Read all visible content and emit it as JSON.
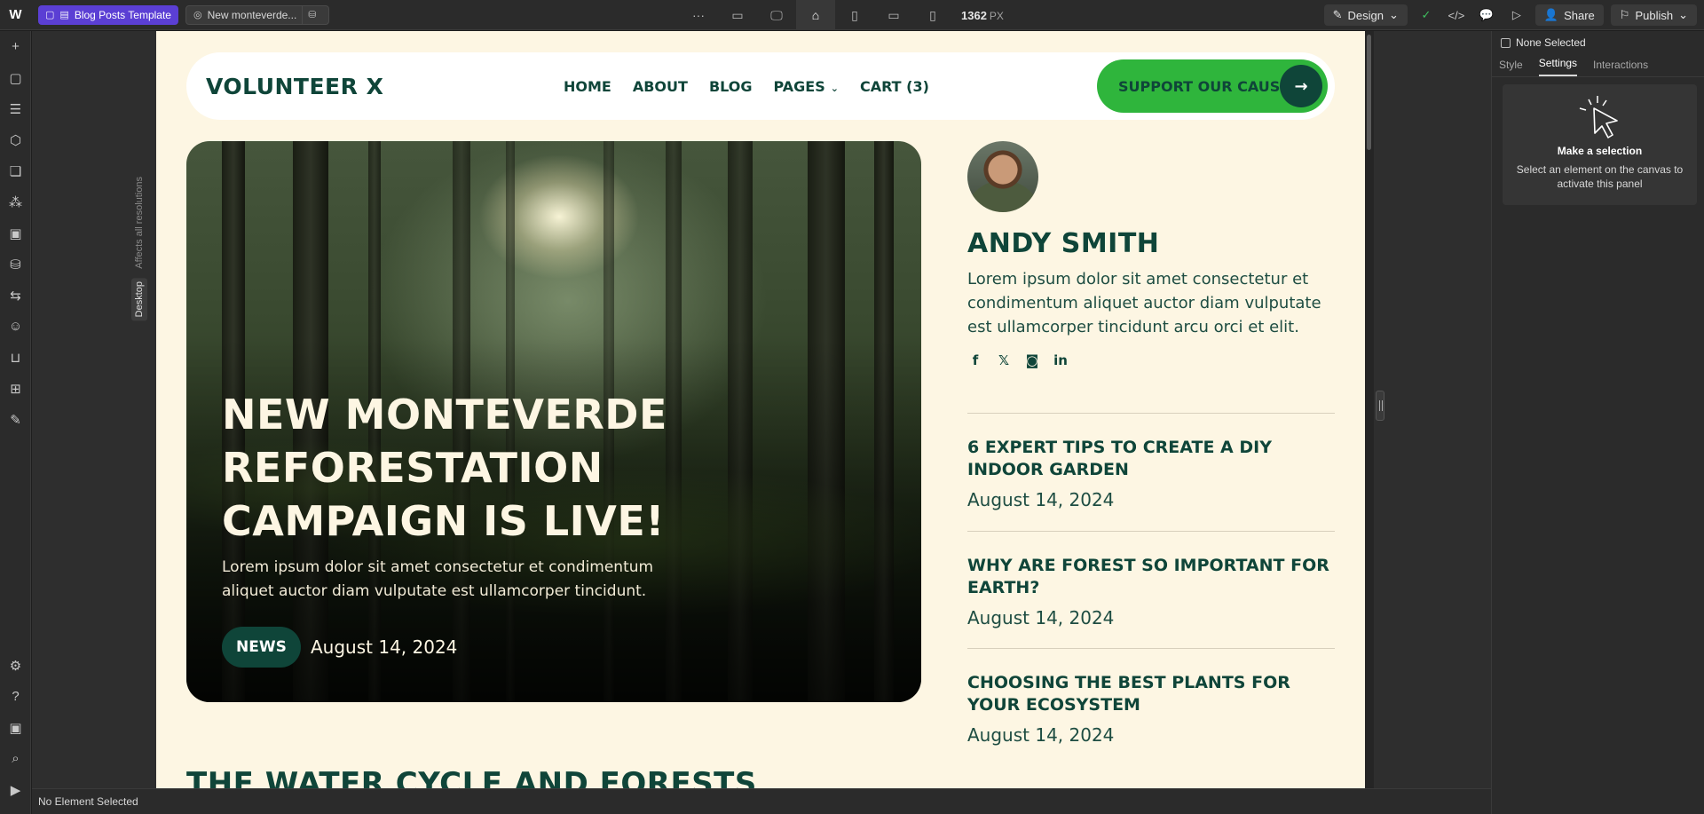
{
  "topbar": {
    "page_pill": "Blog Posts Template",
    "cms_pill": "New monteverde...",
    "more": "···",
    "width_value": "1362",
    "width_unit": "PX",
    "design_label": "Design",
    "share_label": "Share",
    "publish_label": "Publish"
  },
  "canvas": {
    "tag_resolutions": "Affects all resolutions",
    "tag_desktop": "Desktop"
  },
  "site": {
    "brand": "VOLUNTEER X",
    "nav": [
      "HOME",
      "ABOUT",
      "BLOG",
      "PAGES",
      "CART (3)"
    ],
    "cta": "SUPPORT OUR CAUSE",
    "cta_arrow": "→",
    "hero": {
      "title": "NEW MONTEVERDE REFORESTATION CAMPAIGN IS LIVE!",
      "text": "Lorem ipsum dolor sit amet consectetur et condimentum aliquet auctor diam vulputate est ullamcorper tincidunt.",
      "badge": "NEWS",
      "date": "August 14, 2024"
    },
    "author": {
      "name": "ANDY SMITH",
      "bio": "Lorem ipsum dolor sit amet consectetur et condimentum aliquet auctor diam vulputate est ullamcorper tincidunt arcu orci et elit.",
      "socials": [
        "f",
        "𝕏",
        "◙",
        "in"
      ]
    },
    "posts": [
      {
        "title": "6 EXPERT TIPS TO CREATE A DIY INDOOR GARDEN",
        "date": "August 14, 2024"
      },
      {
        "title": "WHY ARE FOREST SO IMPORTANT FOR EARTH?",
        "date": "August 14, 2024"
      },
      {
        "title": "CHOOSING THE BEST PLANTS FOR YOUR ECOSYSTEM",
        "date": "August 14, 2024"
      }
    ],
    "next_section_title": "THE WATER CYCLE AND FORESTS"
  },
  "rpanel": {
    "selection": "None Selected",
    "tabs": [
      "Style",
      "Settings",
      "Interactions"
    ],
    "active_tab": "Settings",
    "card_title": "Make a selection",
    "card_text": "Select an element on the canvas to activate this panel"
  },
  "statusbar": {
    "text": "No Element Selected"
  },
  "colors": {
    "accent": "#5b3fd4",
    "site_bg": "#fdf6e3",
    "site_dark_green": "#0f4539",
    "cta_green": "#2fb53c"
  }
}
